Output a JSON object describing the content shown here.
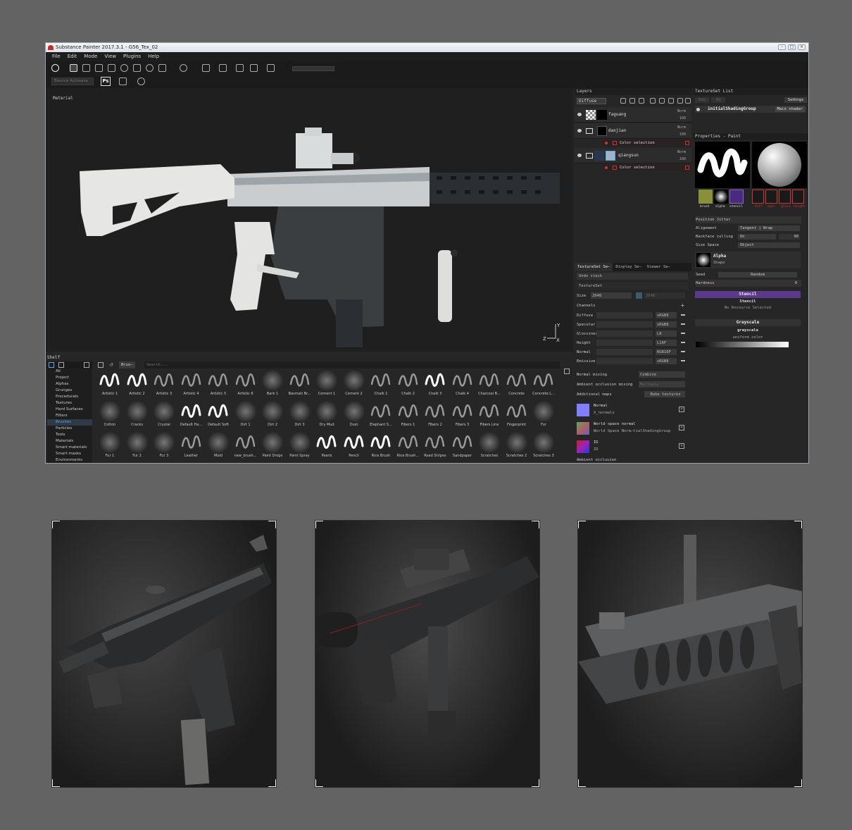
{
  "window": {
    "title": "Substance Painter 2017.3.1 - G56_Tex_02",
    "menu": [
      "File",
      "Edit",
      "Mode",
      "View",
      "Plugins",
      "Help"
    ],
    "toolbar2_field": "Bounce Autosave"
  },
  "viewport": {
    "label": "Material"
  },
  "layers": {
    "title": "Layers",
    "channel": "Diffuse",
    "rows": [
      {
        "name": "faguang",
        "blend": "Norm",
        "opacity": "100"
      },
      {
        "name": "danjian",
        "blend": "Norm",
        "opacity": "100",
        "mask": "Color selection"
      },
      {
        "name": "qiangsun",
        "blend": "Norm",
        "opacity": "100",
        "mask": "Color selection"
      }
    ]
  },
  "texset": {
    "tabs": [
      "TextureSet Se—",
      "Display Se—",
      "Viewer Se—"
    ],
    "undo": "Undo stack",
    "section": "TextureSet",
    "size_label": "Size",
    "size_value": "2048",
    "size_value2": "2048",
    "channels_label": "Channels",
    "channels": [
      {
        "name": "Diffuse",
        "format": "sRGB8"
      },
      {
        "name": "Specular",
        "format": "sRGB8"
      },
      {
        "name": "Glossiness",
        "format": "L8"
      },
      {
        "name": "Height",
        "format": "L16F"
      },
      {
        "name": "Normal",
        "format": "RGB16F"
      },
      {
        "name": "Emissive",
        "format": "sRGB8"
      }
    ],
    "normal_mixing_label": "Normal mixing",
    "normal_mixing_value": "Combine",
    "ao_mixing_label": "Ambient occlusion mixing",
    "ao_mixing_value": "Multiply",
    "additional_maps_label": "Additional maps",
    "bake_button": "Bake textures",
    "maps": [
      {
        "name": "Normal",
        "file": "X_normals"
      },
      {
        "name": "World space normal",
        "file": "World Space Norm—tialShadingGroup"
      },
      {
        "name": "ID",
        "file": "ID"
      }
    ],
    "ao_cut": "Ambient occlusion"
  },
  "tsl": {
    "title": "TextureSet List",
    "btn1": "Solo",
    "btn2": "All",
    "settings": "Settings",
    "item": "initialShadingGroup",
    "shader": "Main shader"
  },
  "props": {
    "title": "Properties - Paint",
    "thumbs": [
      "brush",
      "alpha",
      "stencil"
    ],
    "mats": [
      "diff",
      "spec",
      "gloss",
      "height"
    ],
    "rows": [
      {
        "label": "Position Jitter",
        "value": ""
      },
      {
        "label": "Alignment",
        "value": "Tangent | Wrap"
      },
      {
        "label": "Backface culling",
        "value": "On",
        "num": "90"
      },
      {
        "label": "Size Space",
        "value": "Object"
      }
    ],
    "alpha_title": "Alpha",
    "alpha_sub": "Shape",
    "seed_label": "Seed",
    "seed_value": "Random",
    "hardness_label": "Hardness",
    "hardness_value": "0",
    "stencil_title": "Stencil",
    "stencil_sub": "Stencil",
    "stencil_none": "No Resource Selected",
    "grayscale_title": "Grayscale",
    "grayscale_sub": "grayscale",
    "grayscale_uniform": "uniform color"
  },
  "shelf": {
    "title": "Shelf",
    "filter_tag": "Brus—",
    "search_placeholder": "Search...",
    "categories": [
      "All",
      "Project",
      "Alphas",
      "Grunges",
      "Procedurals",
      "Textures",
      "Hard Surfaces",
      "Filters",
      "Brushes",
      "Particles",
      "Tools",
      "Materials",
      "Smart materials",
      "Smart masks",
      "Environments"
    ],
    "active_category": "Brushes",
    "brushes_row1": [
      "Artistic 1",
      "Artistic 2",
      "Artistic 3",
      "Artistic 4",
      "Artistic 5",
      "Artistic 6",
      "Bark 1",
      "Basmati Br...",
      "Cement 1",
      "Cement 2",
      "Chalk 1",
      "Chalk 2",
      "Chalk 3",
      "Chalk 4",
      "Charcoal B...",
      "Concrete",
      "Concrete L..."
    ],
    "brushes_row2": [
      "Cotton",
      "Cracks",
      "Crystal",
      "Default Ha...",
      "Default Soft",
      "Dirt 1",
      "Dirt 2",
      "Dirt 3",
      "Dry Mud",
      "Dust",
      "Elephant S...",
      "Fibers 1",
      "Fibers 2",
      "Fibers 3",
      "Fibers Line",
      "Fingerprint",
      "Fur"
    ],
    "brushes_row3": [
      "Fur 1",
      "Fur 2",
      "Fur 3",
      "Leather",
      "Mold",
      "new_brush...",
      "Paint Drops",
      "Paint Spray",
      "Pearls",
      "Pencil",
      "Rice Brush",
      "Rice Brush...",
      "Road Stripes",
      "Sandpaper",
      "Scratches",
      "Scratches 2",
      "Scratches 3"
    ]
  },
  "colors": {
    "accent_blue": "#5aa9e6",
    "stencil_purple": "#5b3a8c",
    "mask_red": "#c33333",
    "background": "#636363"
  }
}
